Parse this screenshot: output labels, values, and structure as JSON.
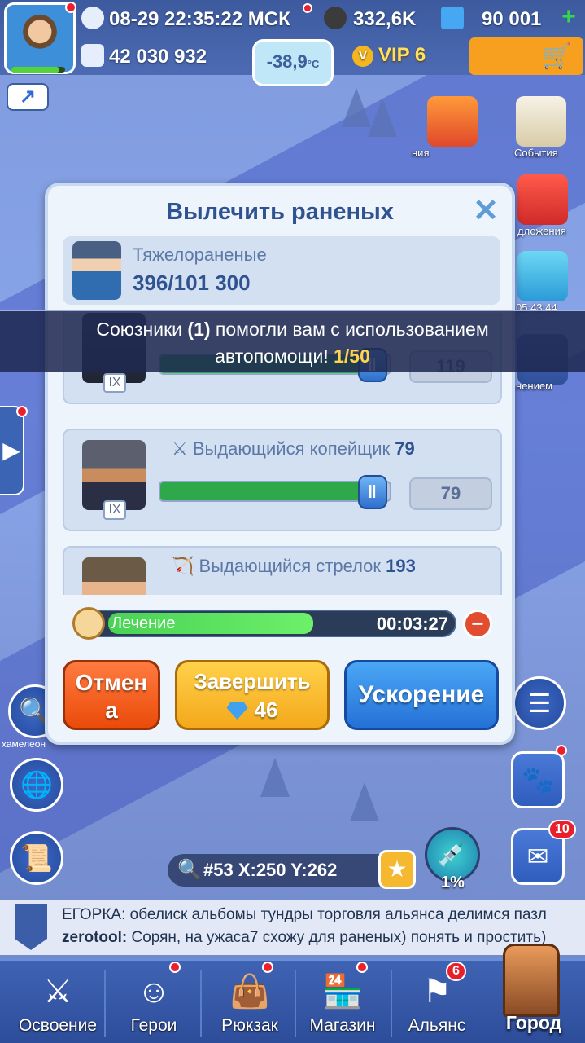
{
  "topbar": {
    "datetime": "08-29 22:35:22 МСК",
    "stone": "332,6K",
    "gems": "90 001",
    "power": "42 030 932",
    "temperature": "-38,9",
    "temperature_unit": "°C",
    "vip": "VIP 6",
    "vip_badge": "V"
  },
  "side_events": {
    "event1_label": "ния",
    "event2_label": "События",
    "event3_label": "дложения",
    "event4_label": "05:43:44",
    "event5_label": "нением"
  },
  "notice": {
    "part1": "Союзники ",
    "count": "(1)",
    "part2": " помогли вам с использованием",
    "part3": "автопомощи! ",
    "progress": "1/50"
  },
  "dialog": {
    "title": "Вылечить раненых",
    "close": "✕",
    "wounded_label": "Тяжелораненые",
    "wounded_value": "396/101 300",
    "units": [
      {
        "name": "",
        "count": "119",
        "tier": "IX",
        "fill": 0.9
      },
      {
        "name": "Выдающийся копейщик",
        "num": "79",
        "count": "79",
        "tier": "IX",
        "fill": 0.9
      },
      {
        "name": "Выдающийся стрелок",
        "num": "193",
        "count": "",
        "tier": "IX",
        "fill": 0.9
      }
    ],
    "heal_label": "Лечение",
    "heal_time": "00:03:27",
    "heal_progress": 0.6,
    "cancel_label_1": "Отмен",
    "cancel_label_2": "а",
    "finish_label": "Завершить",
    "finish_cost": "46",
    "speedup_label": "Ускорение"
  },
  "left": {
    "chameleon_label": "хамелеон"
  },
  "map": {
    "coords": "#53 X:250  Y:262",
    "potion_percent": "1%",
    "mail_badge": "10"
  },
  "chat": {
    "line1_user": "ЕГОРКА:",
    "line1_text": " обелиск альбомы тундры торговля альянса делимся пазл",
    "line2_user": "zerotool:",
    "line2_text": " Сорян, на ужаса7 схожу для раненых) понять и простить)"
  },
  "nav": {
    "items": [
      "Освоение",
      "Герои",
      "Рюкзак",
      "Магазин",
      "Альянс"
    ],
    "alliance_badge": "6",
    "city": "Город"
  },
  "colors": {
    "accent_blue": "#2f5290",
    "progress_green": "#2ea84a",
    "cancel_orange": "#ea4b0a",
    "finish_yellow": "#f4a81b",
    "speed_blue": "#2571d7"
  }
}
